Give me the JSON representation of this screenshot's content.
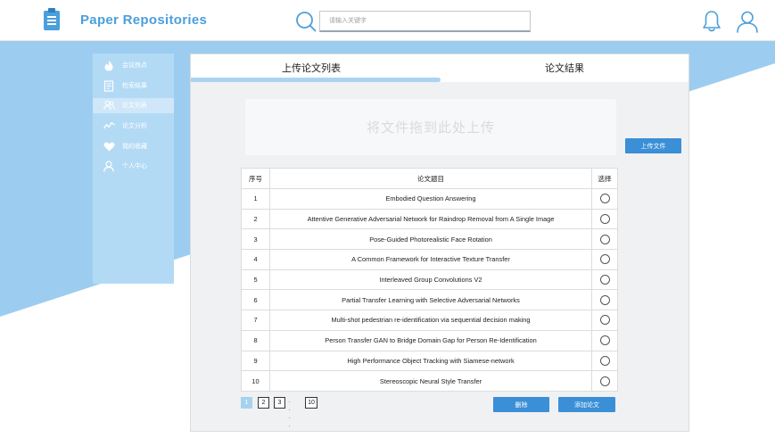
{
  "header": {
    "app_title": "Paper Repositories",
    "search_placeholder": "请输入关键字"
  },
  "colors": {
    "accent": "#3a8fd6",
    "brand": "#4a9fdc",
    "sidebar_bg": "#b3daf5",
    "band_bg": "#9ccdf0"
  },
  "sidebar": {
    "items": [
      {
        "label": "会议热点",
        "icon": "flame-icon"
      },
      {
        "label": "检索结果",
        "icon": "document-icon"
      },
      {
        "label": "论文列表",
        "icon": "users-icon",
        "active": true
      },
      {
        "label": "论文分析",
        "icon": "analytics-icon"
      },
      {
        "label": "我的收藏",
        "icon": "heart-icon"
      },
      {
        "label": "个人中心",
        "icon": "user-icon"
      }
    ]
  },
  "tabs": [
    {
      "label": "上传论文列表",
      "active": true
    },
    {
      "label": "论文结果",
      "active": false
    }
  ],
  "upload": {
    "dropzone_text": "将文件拖到此处上传",
    "upload_button": "上传文件"
  },
  "table": {
    "headers": {
      "index": "序号",
      "title": "论文题目",
      "select": "选择"
    },
    "rows": [
      {
        "index": "1",
        "title": "Embodied Question Answering"
      },
      {
        "index": "2",
        "title": "Attentive Generative Adversarial Network for Raindrop Removal from A Single Image"
      },
      {
        "index": "3",
        "title": "Pose-Guided Photorealistic Face Rotation"
      },
      {
        "index": "4",
        "title": "A Common Framework for Interactive Texture Transfer"
      },
      {
        "index": "5",
        "title": "Interleaved Group Convolutions V2"
      },
      {
        "index": "6",
        "title": "Partial Transfer Learning with Selective Adversarial Networks"
      },
      {
        "index": "7",
        "title": "Multi-shot pedestrian re-identification via sequential decision making"
      },
      {
        "index": "8",
        "title": "Person Transfer GAN to Bridge Domain Gap for Person Re-Identification"
      },
      {
        "index": "9",
        "title": "High Performance Object Tracking with Siamese-network"
      },
      {
        "index": "10",
        "title": "Stereoscopic Neural Style Transfer"
      }
    ]
  },
  "pagination": {
    "pages": [
      "1",
      "2",
      "3"
    ],
    "ellipsis": "· · · ·",
    "last": "10",
    "current": "1"
  },
  "actions": {
    "delete_label": "删除",
    "add_label": "添加论文"
  }
}
